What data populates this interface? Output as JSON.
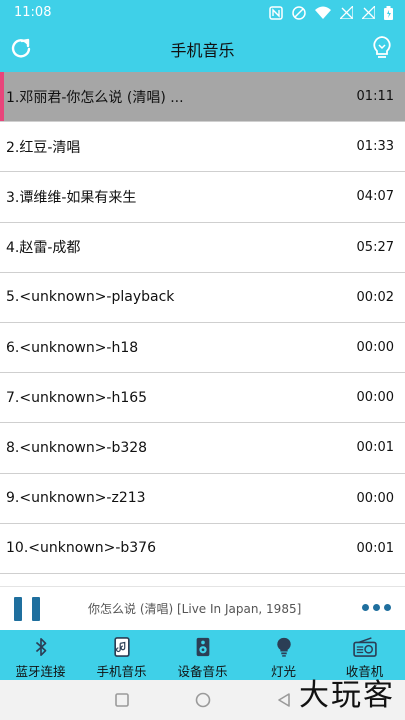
{
  "status_bar": {
    "time": "11:08"
  },
  "app_bar": {
    "title": "手机音乐"
  },
  "songs": [
    {
      "title": "1.邓丽君-你怎么说 (清唱) ...",
      "duration": "01:11"
    },
    {
      "title": "2.红豆-清唱",
      "duration": "01:33"
    },
    {
      "title": "3.谭维维-如果有来生",
      "duration": "04:07"
    },
    {
      "title": "4.赵雷-成都",
      "duration": "05:27"
    },
    {
      "title": "5.<unknown>-playback",
      "duration": "00:02"
    },
    {
      "title": "6.<unknown>-h18",
      "duration": "00:00"
    },
    {
      "title": "7.<unknown>-h165",
      "duration": "00:00"
    },
    {
      "title": "8.<unknown>-b328",
      "duration": "00:01"
    },
    {
      "title": "9.<unknown>-z213",
      "duration": "00:00"
    },
    {
      "title": "10.<unknown>-b376",
      "duration": "00:01"
    }
  ],
  "now_playing": {
    "track": "你怎么说 (清唱) [Live In Japan, 1985]"
  },
  "tabs": [
    {
      "label": "蓝牙连接",
      "icon": "bluetooth-icon"
    },
    {
      "label": "手机音乐",
      "icon": "phone-icon"
    },
    {
      "label": "设备音乐",
      "icon": "speaker-icon"
    },
    {
      "label": "灯光",
      "icon": "bulb-icon"
    },
    {
      "label": "收音机",
      "icon": "radio-icon"
    }
  ],
  "watermark": "大玩客",
  "colors": {
    "accent": "#3fd0e8",
    "active_row": "#a6a6a6",
    "active_marker": "#e8457b",
    "player_icon": "#1f6f9e"
  }
}
